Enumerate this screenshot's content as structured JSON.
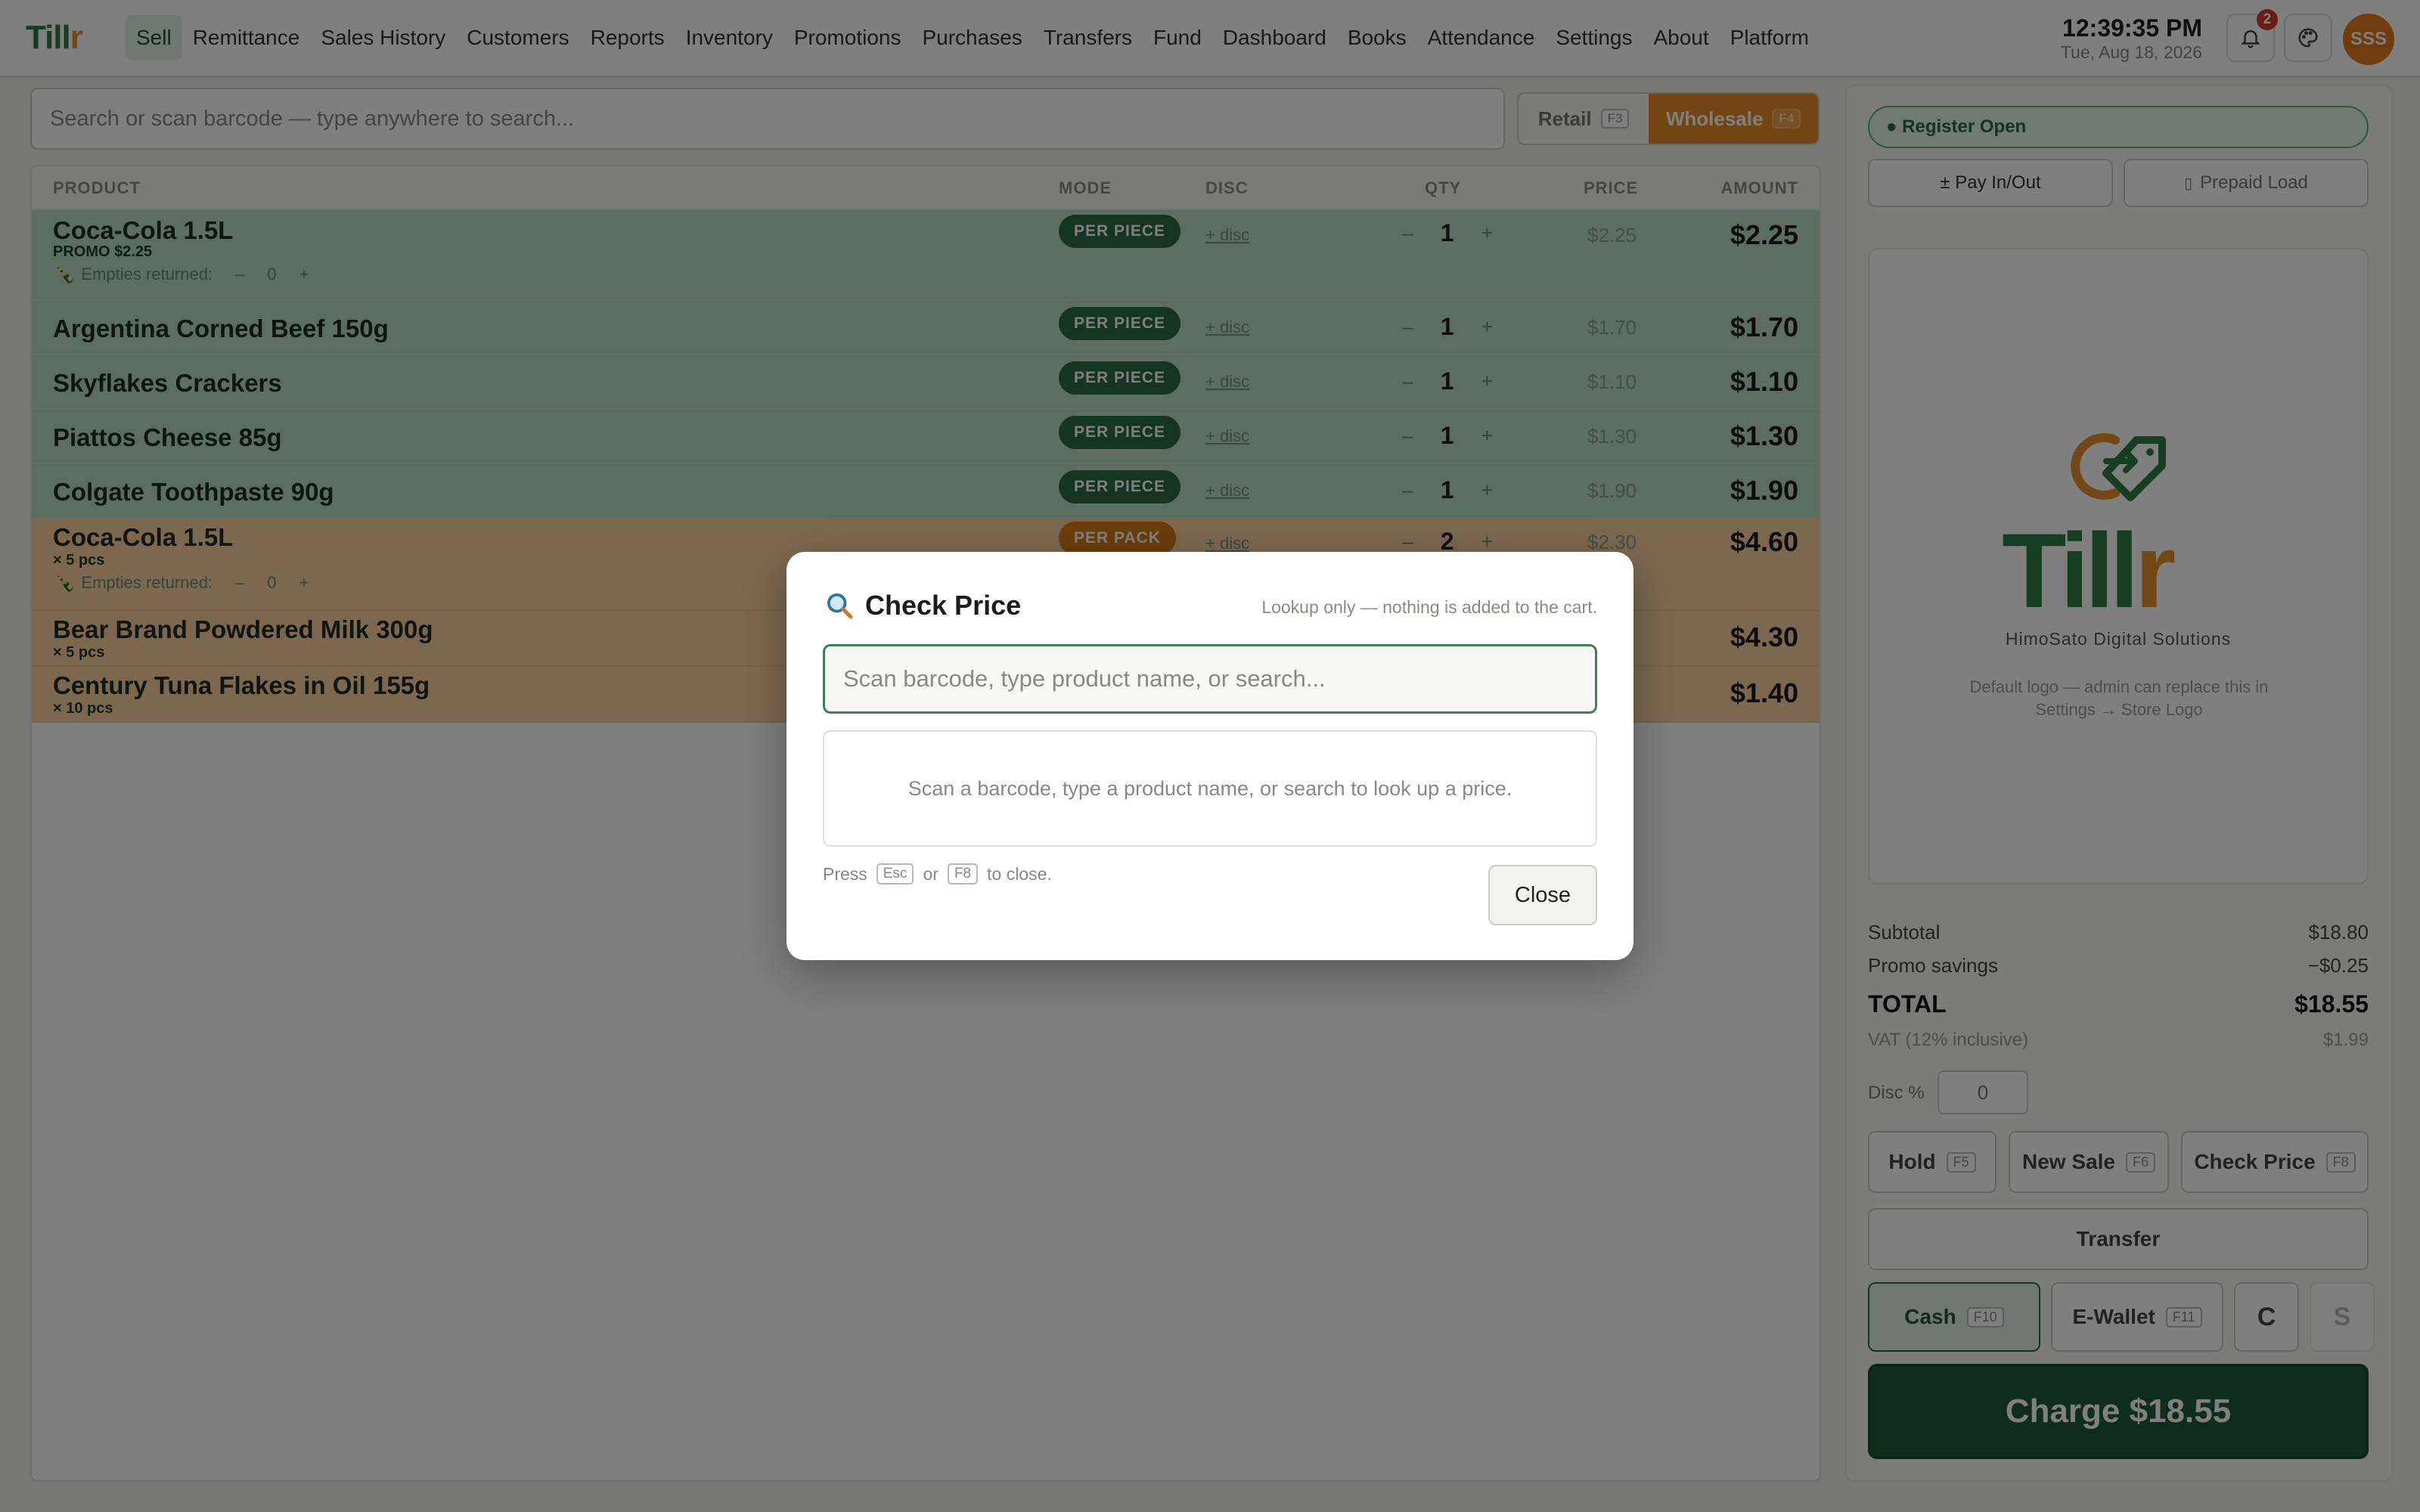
{
  "app": {
    "logo": "Till",
    "logo_accent": "r",
    "brand_color": "#2f7d4a",
    "accent_color": "#e5922c"
  },
  "nav": {
    "items": [
      {
        "label": "Sell",
        "active": true
      },
      {
        "label": "Remittance"
      },
      {
        "label": "Sales History"
      },
      {
        "label": "Customers"
      },
      {
        "label": "Reports"
      },
      {
        "label": "Inventory"
      },
      {
        "label": "Promotions"
      },
      {
        "label": "Purchases"
      },
      {
        "label": "Transfers"
      },
      {
        "label": "Fund"
      },
      {
        "label": "Dashboard"
      },
      {
        "label": "Books"
      },
      {
        "label": "Attendance"
      },
      {
        "label": "Settings"
      },
      {
        "label": "About"
      },
      {
        "label": "Platform"
      }
    ]
  },
  "header": {
    "time": "12:39:35 PM",
    "date": "Tue, Aug 18, 2026",
    "notification_count": "2",
    "avatar_initials": "SSS",
    "icons": [
      "bell-icon",
      "palette-icon"
    ]
  },
  "search": {
    "placeholder": "Search or scan barcode — type anywhere to search..."
  },
  "mode_toggle": {
    "retail_label": "Retail",
    "retail_key": "F3",
    "wholesale_label": "Wholesale",
    "wholesale_key": "F4",
    "selected": "Wholesale"
  },
  "cart": {
    "columns": {
      "product": "PRODUCT",
      "mode": "MODE",
      "disc": "DISC",
      "qty": "QTY",
      "price": "PRICE",
      "amount": "AMOUNT"
    },
    "rows": [
      {
        "name": "Coca-Cola 1.5L",
        "sub": "PROMO $2.25",
        "empties_label": "Empties returned:",
        "empties_minus": "–",
        "empties_count": "0",
        "empties_plus": "+",
        "mode": "PER PIECE",
        "disc": "+ disc",
        "qty": "1",
        "price": "$2.25",
        "amount": "$2.25"
      },
      {
        "name": "Argentina Corned Beef 150g",
        "mode": "PER PIECE",
        "disc": "+ disc",
        "qty": "1",
        "price": "$1.70",
        "amount": "$1.70"
      },
      {
        "name": "Skyflakes Crackers",
        "mode": "PER PIECE",
        "disc": "+ disc",
        "qty": "1",
        "price": "$1.10",
        "amount": "$1.10"
      },
      {
        "name": "Piattos Cheese 85g",
        "mode": "PER PIECE",
        "disc": "+ disc",
        "qty": "1",
        "price": "$1.30",
        "amount": "$1.30"
      },
      {
        "name": "Colgate Toothpaste 90g",
        "mode": "PER PIECE",
        "disc": "+ disc",
        "qty": "1",
        "price": "$1.90",
        "amount": "$1.90"
      },
      {
        "name": "Coca-Cola 1.5L",
        "sub": "× 5 pcs",
        "empties_label": "Empties returned:",
        "empties_minus": "–",
        "empties_count": "0",
        "empties_plus": "+",
        "mode": "PER PACK",
        "disc": "+ disc",
        "qty": "2",
        "price": "$2.30",
        "amount": "$4.60"
      },
      {
        "name": "Bear Brand Powdered Milk 300g",
        "sub": "× 5 pcs",
        "amount": "$4.30"
      },
      {
        "name": "Century Tuna Flakes in Oil 155g",
        "sub": "× 10 pcs",
        "amount": "$1.40"
      }
    ]
  },
  "side": {
    "register_status": "● Register Open",
    "pay_in_out": "± Pay In/Out",
    "prepaid_load": "Prepaid Load",
    "company_name": "HimoSato Digital Solutions",
    "logo_note": "Default logo — admin can replace this in Settings → Store Logo",
    "subtotal_label": "Subtotal",
    "subtotal": "$18.80",
    "promo_label": "Promo savings",
    "promo": "−$0.25",
    "total_label": "TOTAL",
    "total": "$18.55",
    "vat_label": "VAT (12% inclusive)",
    "vat": "$1.99",
    "disc_label": "Disc %",
    "disc_value": "0",
    "hold": "Hold",
    "hold_key": "F5",
    "new_sale": "New Sale",
    "new_sale_key": "F6",
    "check_price": "Check Price",
    "check_price_key": "F8",
    "transfer": "Transfer",
    "cash": "Cash",
    "cash_key": "F10",
    "ewallet": "E-Wallet",
    "ewallet_key": "F11",
    "c_label": "C",
    "s_label": "S",
    "charge": "Charge $18.55"
  },
  "modal": {
    "title": "Check Price",
    "hint": "Lookup only — nothing is added to the cart.",
    "placeholder": "Scan barcode, type product name, or search...",
    "empty_text": "Scan a barcode, type a product name, or search to look up a price.",
    "press": "Press",
    "esc": "Esc",
    "or": "or",
    "f8": "F8",
    "to_close": "to close.",
    "close": "Close"
  }
}
